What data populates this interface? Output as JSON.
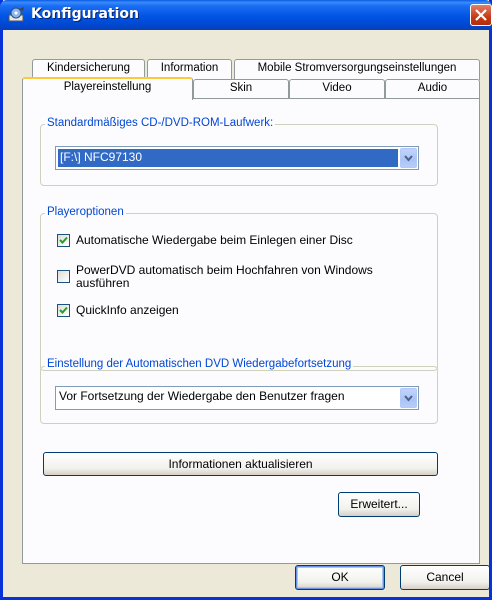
{
  "window": {
    "title": "Konfiguration"
  },
  "tabs": {
    "back_row": [
      "Kindersicherung",
      "Information",
      "Mobile Stromversorgungseinstellungen"
    ],
    "front_row": [
      "Playereinstellung",
      "Skin",
      "Video",
      "Audio"
    ],
    "active": "Playereinstellung"
  },
  "drive_group": {
    "label": "Standardmäßiges CD-/DVD-ROM-Laufwerk:",
    "selected": "[F:\\] NFC97130"
  },
  "player_options": {
    "label": "Playeroptionen",
    "items": [
      {
        "label": "Automatische Wiedergabe beim Einlegen einer Disc",
        "checked": true
      },
      {
        "label": "PowerDVD automatisch beim Hochfahren von Windows ausführen",
        "checked": false
      },
      {
        "label": "QuickInfo anzeigen",
        "checked": true
      }
    ]
  },
  "resume_group": {
    "label": "Einstellung der Automatischen DVD Wiedergabefortsetzung",
    "selected": "Vor Fortsetzung der Wiedergabe den Benutzer fragen"
  },
  "buttons": {
    "refresh": "Informationen aktualisieren",
    "advanced": "Erweitert...",
    "ok": "OK",
    "cancel": "Cancel"
  }
}
